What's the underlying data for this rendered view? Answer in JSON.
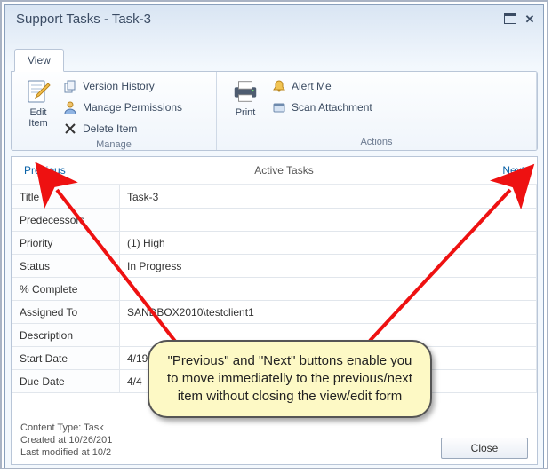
{
  "window": {
    "title": "Support Tasks - Task-3"
  },
  "ribbon": {
    "tab": "View",
    "manage": {
      "label": "Manage",
      "edit_item": "Edit\nItem",
      "version_history": "Version History",
      "manage_permissions": "Manage Permissions",
      "delete_item": "Delete Item"
    },
    "actions": {
      "label": "Actions",
      "print": "Print",
      "alert_me": "Alert Me",
      "scan_attachment": "Scan Attachment"
    }
  },
  "nav": {
    "previous": "Previous",
    "center": "Active Tasks",
    "next": "Next"
  },
  "fields": {
    "title_k": "Title",
    "title_v": "Task-3",
    "pred_k": "Predecessors",
    "pred_v": "",
    "priority_k": "Priority",
    "priority_v": "(1) High",
    "status_k": "Status",
    "status_v": "In Progress",
    "pct_k": "% Complete",
    "pct_v": "",
    "assigned_k": "Assigned To",
    "assigned_v": "SANDBOX2010\\testclient1",
    "desc_k": "Description",
    "desc_v": "",
    "start_k": "Start Date",
    "start_v": "4/19/",
    "due_k": "Due Date",
    "due_v": "4/4"
  },
  "meta": {
    "content_type": "Content Type: Task",
    "created": "Created at 10/26/201",
    "modified": "Last modified at 10/2"
  },
  "buttons": {
    "close": "Close"
  },
  "callout": {
    "text": "\"Previous\" and \"Next\" buttons enable you to move immediatelly to the previous/next item without closing the view/edit form"
  }
}
